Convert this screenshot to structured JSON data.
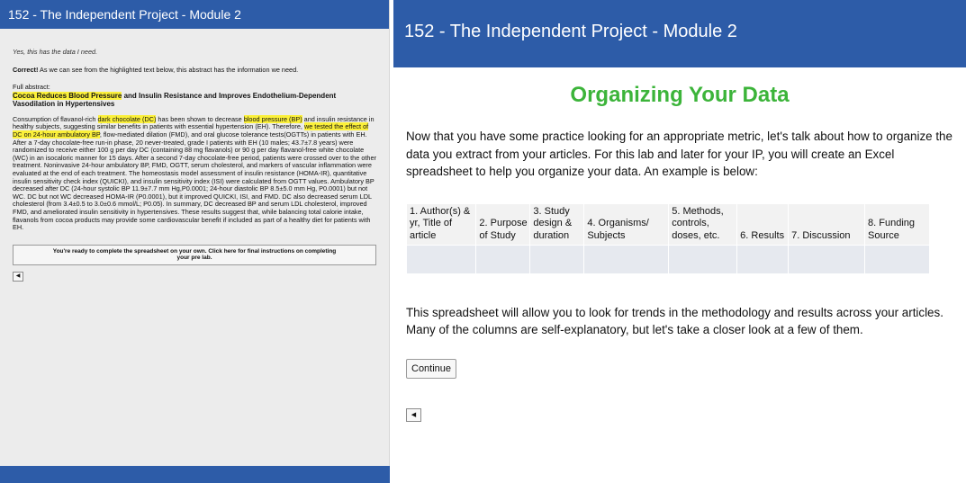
{
  "left": {
    "header_title": "152 - The Independent Project - Module 2",
    "intro": "Yes, this has the data I need.",
    "correct_bold": "Correct!",
    "correct_text": " As we can see from the highlighted text below, this abstract has the information we need.",
    "full_label": "Full abstract:",
    "title_hl": "Cocoa Reduces Blood Pressure",
    "title_rest": " and Insulin Resistance and Improves Endothelium-Dependent Vasodilation in Hypertensives",
    "abstract": {
      "p1": "Consumption of flavanol-rich ",
      "h1": "dark chocolate (DC)",
      "p2": " has been shown to decrease ",
      "h2": "blood pressure (BP)",
      "p3": " and insulin resistance in healthy subjects, suggesting similar benefits in patients with essential hypertension (EH). Therefore, ",
      "h3": "we tested the effect of DC on 24-hour ambulatory BP",
      "p4": ", flow-mediated dilation (FMD), and oral glucose tolerance tests(OGTTs) in patients with EH. After a 7-day chocolate-free run-in phase, 20 never-treated, grade I patients with EH (10 males; 43.7±7.8 years) were randomized to receive either 100 g per day DC (containing 88 mg flavanols) or 90 g per day flavanol-free white chocolate (WC) in an isocaloric manner for 15 days. After a second 7-day chocolate-free period, patients were crossed over to the other treatment. Noninvasive 24-hour ambulatory BP, FMD, OGTT, serum cholesterol, and markers of vascular inflammation were evaluated at the end of each treatment. The homeostasis model assessment of insulin resistance (HOMA-IR), quantitative insulin sensitivity check index (QUICKI), and insulin sensitivity index (ISI) were calculated from OGTT values. Ambulatory BP decreased after DC (24-hour systolic BP 11.9±7.7 mm Hg,P0.0001; 24-hour diastolic BP 8.5±5.0 mm Hg, P0.0001) but not WC. DC but not WC decreased HOMA-IR (P0.0001), but it improved QUICKI, ISI, and FMD. DC also decreased serum LDL cholesterol (from 3.4±0.5 to 3.0±0.6 mmol/L; P0.05). In summary, DC decreased BP and serum LDL cholesterol, improved FMD, and ameliorated insulin sensitivity in hypertensives. These results suggest that, while balancing total calorie intake, flavanols from cocoa products may provide some cardiovascular benefit if included as part of a healthy diet for patients with EH."
    },
    "notice": "You're ready to complete the spreadsheet on your own. Click here for final instructions on completing your pre lab."
  },
  "right": {
    "header_title": "152 - The Independent Project - Module 2",
    "heading": "Organizing Your Data",
    "para1": "Now that you have some practice looking for an appropriate metric, let's talk about how to organize the data you extract from your articles. For this lab and later for your IP, you will create an Excel spreadsheet to help you organize your data. An example is below:",
    "table_headers": [
      "1. Author(s) & yr, Title of article",
      "2. Purpose of Study",
      "3. Study design & duration",
      "4. Organisms/ Subjects",
      "5. Methods, controls, doses, etc.",
      "6. Results",
      "7. Discussion",
      "8. Funding Source"
    ],
    "para2": "This spreadsheet will allow you to look for trends in the methodology and results across your articles. Many of the columns are self-explanatory, but let's take a closer look at a few of them.",
    "continue_label": "Continue"
  },
  "colors": {
    "header_blue": "#2d5ca8",
    "heading_green": "#3cb43a",
    "highlight_yellow": "#fbf03a"
  }
}
